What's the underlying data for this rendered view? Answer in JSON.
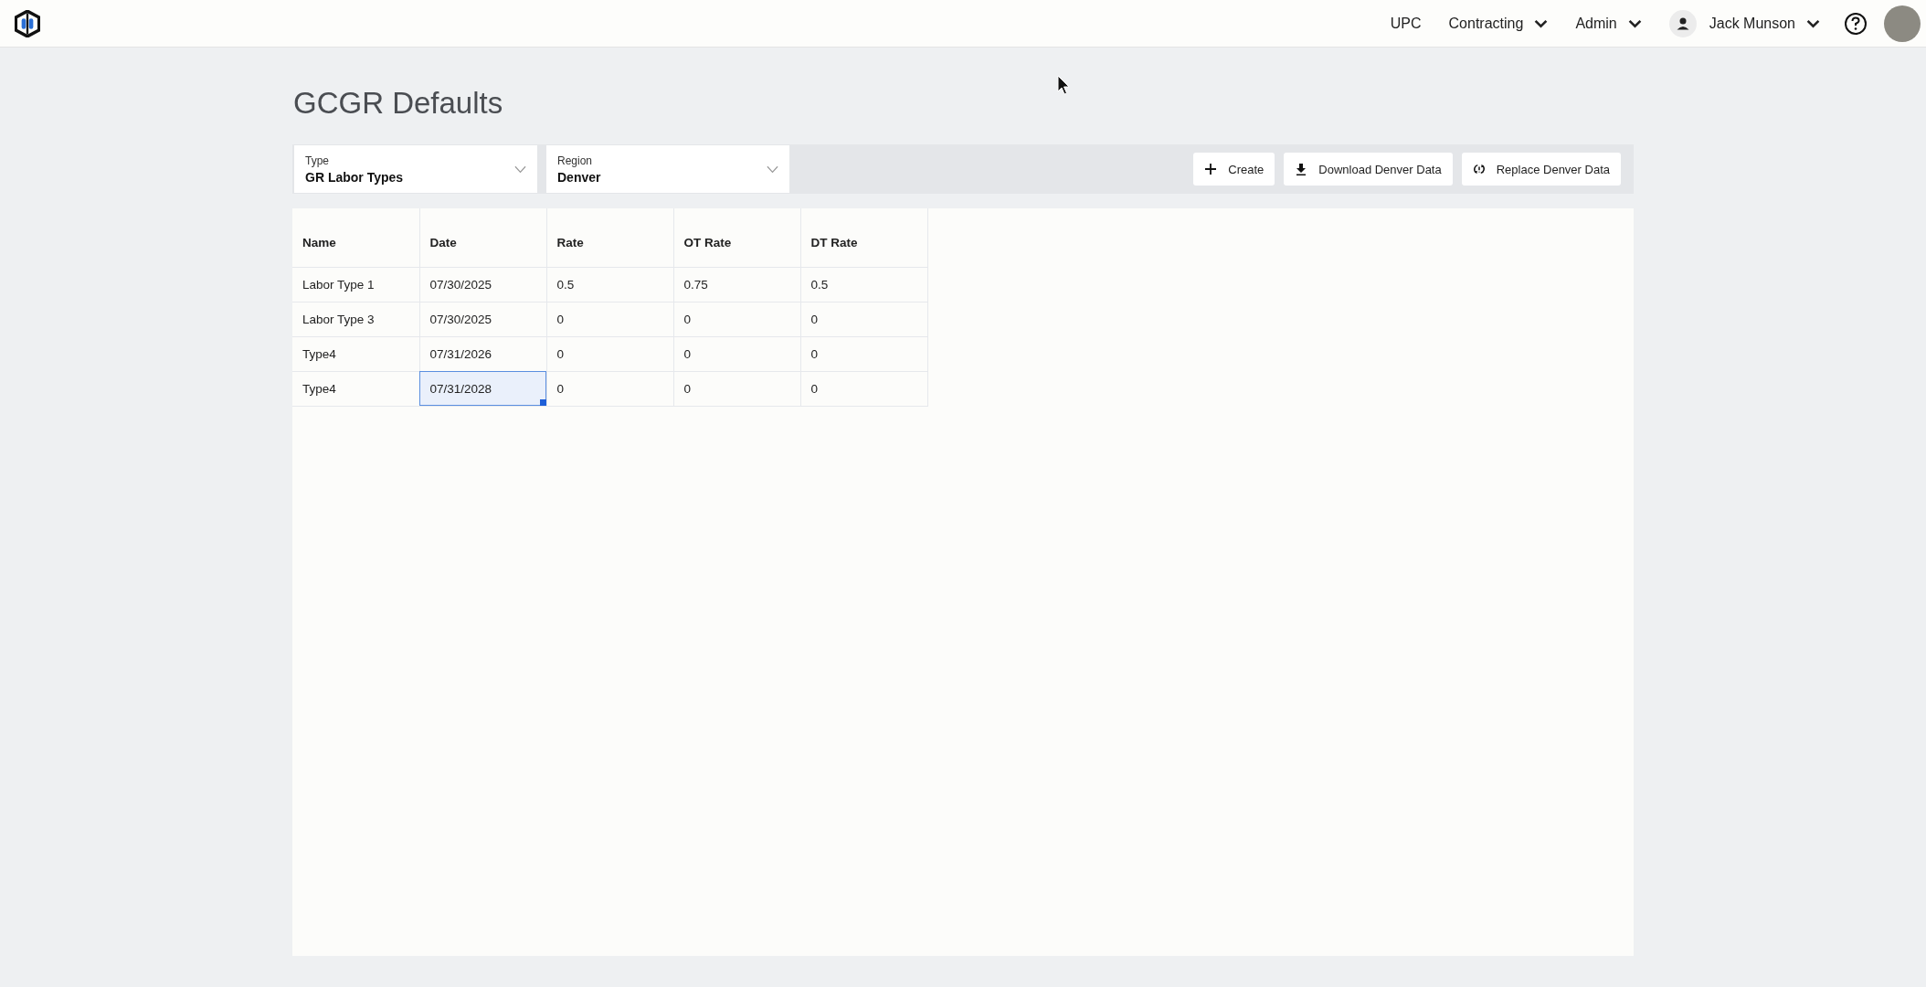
{
  "nav": {
    "items": [
      {
        "label": "UPC",
        "kind": "link"
      },
      {
        "label": "Contracting",
        "kind": "menu"
      },
      {
        "label": "Admin",
        "kind": "menu"
      }
    ],
    "user": {
      "name": "Jack Munson"
    }
  },
  "page_title": "GCGR Defaults",
  "filters": [
    {
      "label": "Type",
      "value": "GR Labor Types"
    },
    {
      "label": "Region",
      "value": "Denver"
    }
  ],
  "actions": [
    {
      "label": "Create",
      "kind": "create"
    },
    {
      "label": "Download Denver Data",
      "kind": "download"
    },
    {
      "label": "Replace Denver Data",
      "kind": "replace"
    }
  ],
  "table": {
    "columns": [
      "Name",
      "Date",
      "Rate",
      "OT Rate",
      "DT Rate"
    ],
    "rows": [
      {
        "cells": [
          {
            "text": "Labor Type 1",
            "selected": false
          },
          {
            "text": "07/30/2025",
            "selected": false
          },
          {
            "text": "0.5",
            "selected": false
          },
          {
            "text": "0.75",
            "selected": false
          },
          {
            "text": "0.5",
            "selected": false
          }
        ]
      },
      {
        "cells": [
          {
            "text": "Labor Type 3",
            "selected": false
          },
          {
            "text": "07/30/2025",
            "selected": false
          },
          {
            "text": "0",
            "selected": false
          },
          {
            "text": "0",
            "selected": false
          },
          {
            "text": "0",
            "selected": false
          }
        ]
      },
      {
        "cells": [
          {
            "text": "Type4",
            "selected": false
          },
          {
            "text": "07/31/2026",
            "selected": false
          },
          {
            "text": "0",
            "selected": false
          },
          {
            "text": "0",
            "selected": false
          },
          {
            "text": "0",
            "selected": false
          }
        ]
      },
      {
        "cells": [
          {
            "text": "Type4",
            "selected": false
          },
          {
            "text": "07/31/2028",
            "selected": true
          },
          {
            "text": "0",
            "selected": false
          },
          {
            "text": "0",
            "selected": false
          },
          {
            "text": "0",
            "selected": false
          }
        ]
      }
    ]
  }
}
